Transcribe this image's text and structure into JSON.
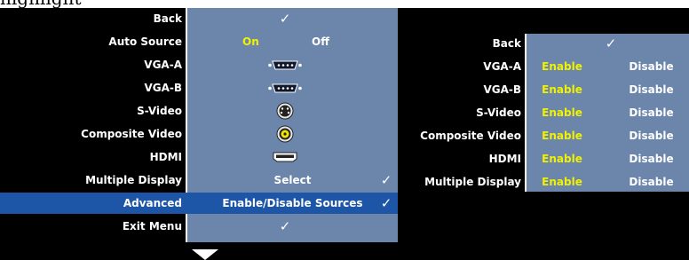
{
  "heading": {
    "text": "highlight"
  },
  "menu": {
    "rows": [
      {
        "label": "Back",
        "value": "✓"
      },
      {
        "label": "Auto Source",
        "on": "On",
        "off": "Off"
      },
      {
        "label": "VGA-A",
        "icon": "vga-port-icon"
      },
      {
        "label": "VGA-B",
        "icon": "vga-port-icon"
      },
      {
        "label": "S-Video",
        "icon": "svideo-port-icon"
      },
      {
        "label": "Composite Video",
        "icon": "composite-video-port-icon"
      },
      {
        "label": "HDMI",
        "icon": "hdmi-port-icon"
      },
      {
        "label": "Multiple Display",
        "value": "Select",
        "check": "✓"
      },
      {
        "label": "Advanced",
        "value": "Enable/Disable Sources",
        "check": "✓",
        "selected": true
      },
      {
        "label": "Exit Menu",
        "value": "✓"
      }
    ]
  },
  "submenu": {
    "header": {
      "label": "Back",
      "check": "✓"
    },
    "rows": [
      {
        "label": "VGA-A",
        "enable": "Enable",
        "disable": "Disable"
      },
      {
        "label": "VGA-B",
        "enable": "Enable",
        "disable": "Disable"
      },
      {
        "label": "S-Video",
        "enable": "Enable",
        "disable": "Disable"
      },
      {
        "label": "Composite Video",
        "enable": "Enable",
        "disable": "Disable"
      },
      {
        "label": "HDMI",
        "enable": "Enable",
        "disable": "Disable"
      },
      {
        "label": "Multiple Display",
        "enable": "Enable",
        "disable": "Disable"
      }
    ]
  },
  "colors": {
    "menu_blue": "#6b85ab",
    "selected_blue": "#1d56a6",
    "enable_yellow": "#f2f200"
  },
  "scroll_indicator": {
    "icon": "down-arrow-icon"
  }
}
